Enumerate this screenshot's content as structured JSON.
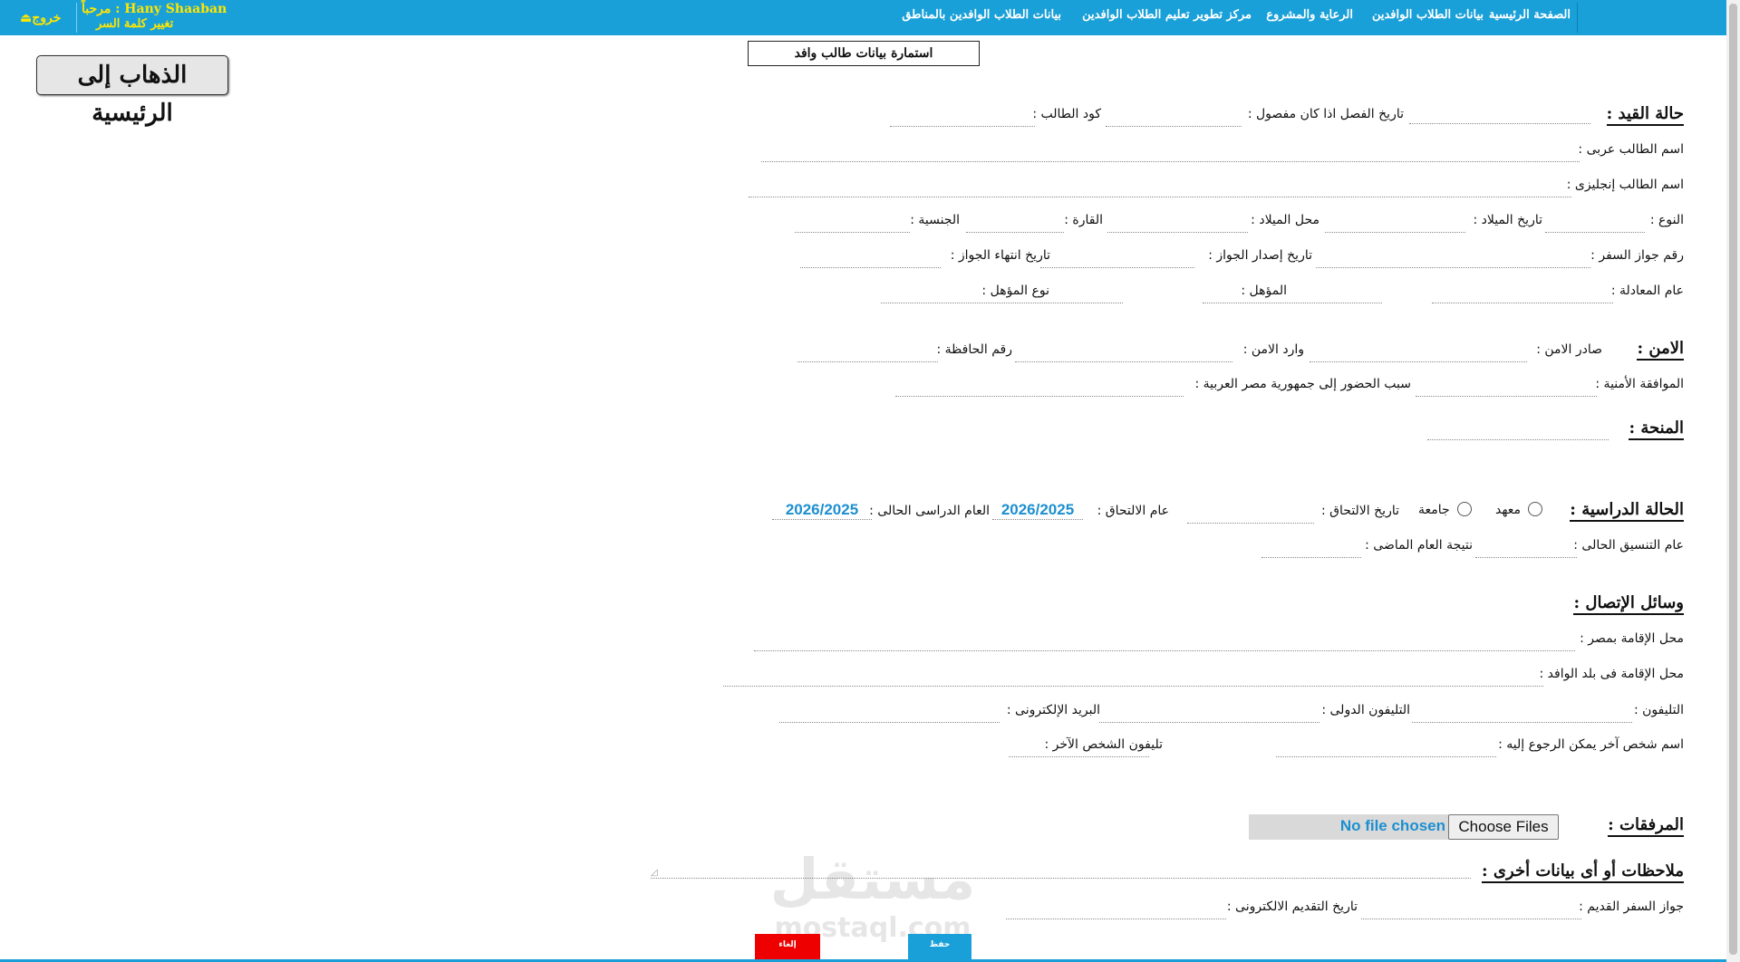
{
  "header": {
    "nav": [
      "الصفحة الرئيسية",
      "بيانات الطلاب الوافدين",
      "الرعاية والمشروع",
      "مركز تطوير تعليم الطلاب الوافدين",
      "بيانات الطلاب الوافدين بالمناطق"
    ],
    "welcome": "مرحباً : Hany Shaaban",
    "change_password": "تغيير كلمة السر",
    "logout": "خروج",
    "logout_icon": "logout-icon"
  },
  "form_title": "استمارة بيانات طالب وافد",
  "home_button": "الذهاب إلى الرئيسية",
  "enrollment": {
    "title": "حالة القيد :",
    "dismissal_date": "تاريخ الفصل اذا كان مفصول :",
    "student_code": "كود الطالب :",
    "name_ar": "اسم الطالب عربى :",
    "name_en": "اسم الطالب إنجليزى :",
    "gender": "النوع :",
    "birth_date": "تاريخ الميلاد :",
    "birth_place": "محل الميلاد :",
    "continent": "القارة :",
    "nationality": "الجنسية :",
    "passport_no": "رقم جواز السفر :",
    "passport_issue": "تاريخ إصدار الجواز :",
    "passport_expiry": "تاريخ انتهاء الجواز :",
    "equivalency_year": "عام المعادلة :",
    "qualification": "المؤهل :",
    "qualification_type": "نوع المؤهل :"
  },
  "security": {
    "title": "الامن :",
    "issued": "صادر الامن :",
    "incoming": "وارد الامن :",
    "folder_no": "رقم الحافظة :",
    "approval": "الموافقة الأمنية :",
    "reason": "سبب الحضور إلى جمهورية مصر العربية :"
  },
  "scholarship": {
    "title": "المنحة :"
  },
  "study": {
    "title": "الحالة الدراسية :",
    "institute": "معهد",
    "university": "جامعة",
    "join_date": "تاريخ الالتحاق :",
    "join_year": "عام الالتحاق :",
    "join_year_value": "2026/2025",
    "current_year": "العام الدراسى الحالى :",
    "current_year_value": "2026/2025",
    "coordination_year": "عام التنسيق الحالى :",
    "last_result": "نتيجة العام الماضى :"
  },
  "contact": {
    "title": "وسائل الإتصال :",
    "residence_egypt": "محل الإقامة بمصر :",
    "residence_home": "محل الإقامة فى بلد الوافد :",
    "phone": "التليفون :",
    "intl_phone": "التليفون الدولى :",
    "email": "البريد الإلكترونى :",
    "contact_person": "اسم شخص آخر يمكن الرجوع إليه :",
    "contact_phone": "تليفون الشخص الآخر :"
  },
  "attachments": {
    "title": "المرفقات :",
    "choose": "Choose Files",
    "status": "No file chosen"
  },
  "notes": {
    "title": "ملاحظات أو أى بيانات أخرى :",
    "old_passport": "جواز السفر القديم :",
    "submit_date": "تاريخ التقديم الالكترونى :"
  },
  "buttons": {
    "save": "حفظ",
    "cancel": "إلغاء"
  },
  "watermark": {
    "text": "مستقل",
    "site": "mostaql.com"
  },
  "colors": {
    "bar": "#1aa0d8",
    "welcome": "#ffe600",
    "value": "#1d8fd0",
    "cancel": "#ee0000"
  }
}
